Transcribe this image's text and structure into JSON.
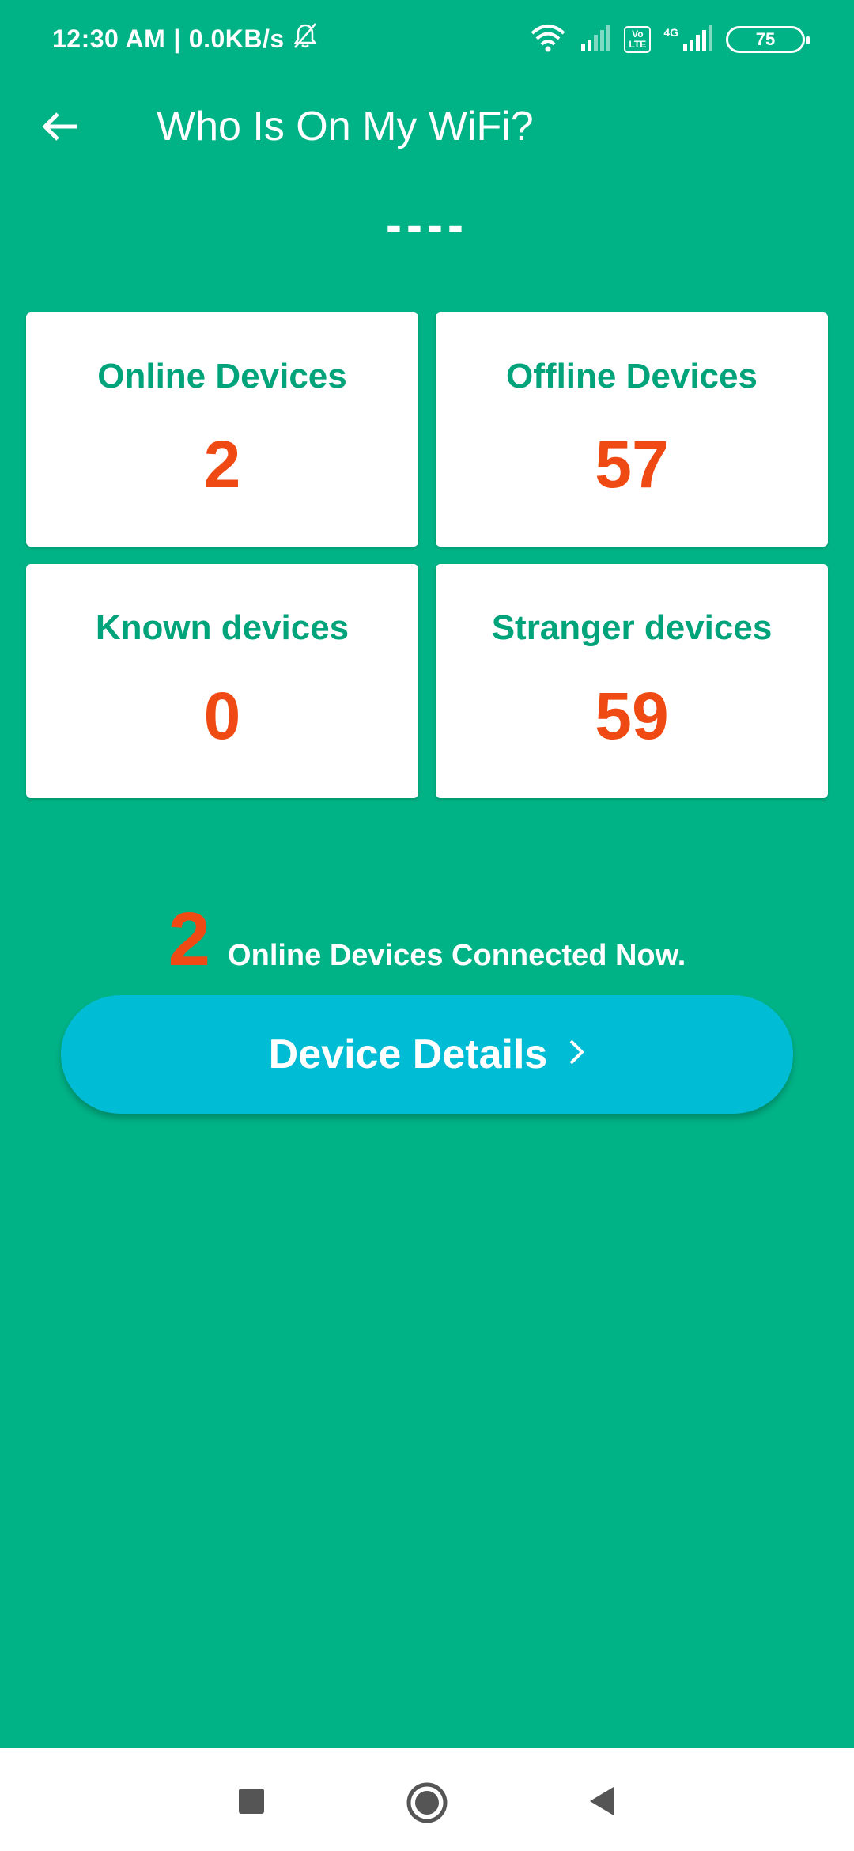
{
  "status_bar": {
    "time": "12:30 AM",
    "speed": "0.0KB/s",
    "network": "4G",
    "volte": "Vo LTE",
    "battery": "75"
  },
  "app_bar": {
    "title": "Who Is On My WiFi?",
    "back_icon": "arrow-left-icon"
  },
  "network_name": "----",
  "stats": {
    "online": {
      "label": "Online Devices",
      "value": "2"
    },
    "offline": {
      "label": "Offline Devices",
      "value": "57"
    },
    "known": {
      "label": "Known devices",
      "value": "0"
    },
    "stranger": {
      "label": "Stranger devices",
      "value": "59"
    }
  },
  "summary": {
    "count": "2",
    "text": "Online Devices Connected Now."
  },
  "details_button": {
    "label": "Device Details",
    "icon": "chevron-right-icon"
  },
  "colors": {
    "background": "#00B386",
    "card_label": "#00A37A",
    "value": "#F04A14",
    "button": "#00BCD4"
  }
}
